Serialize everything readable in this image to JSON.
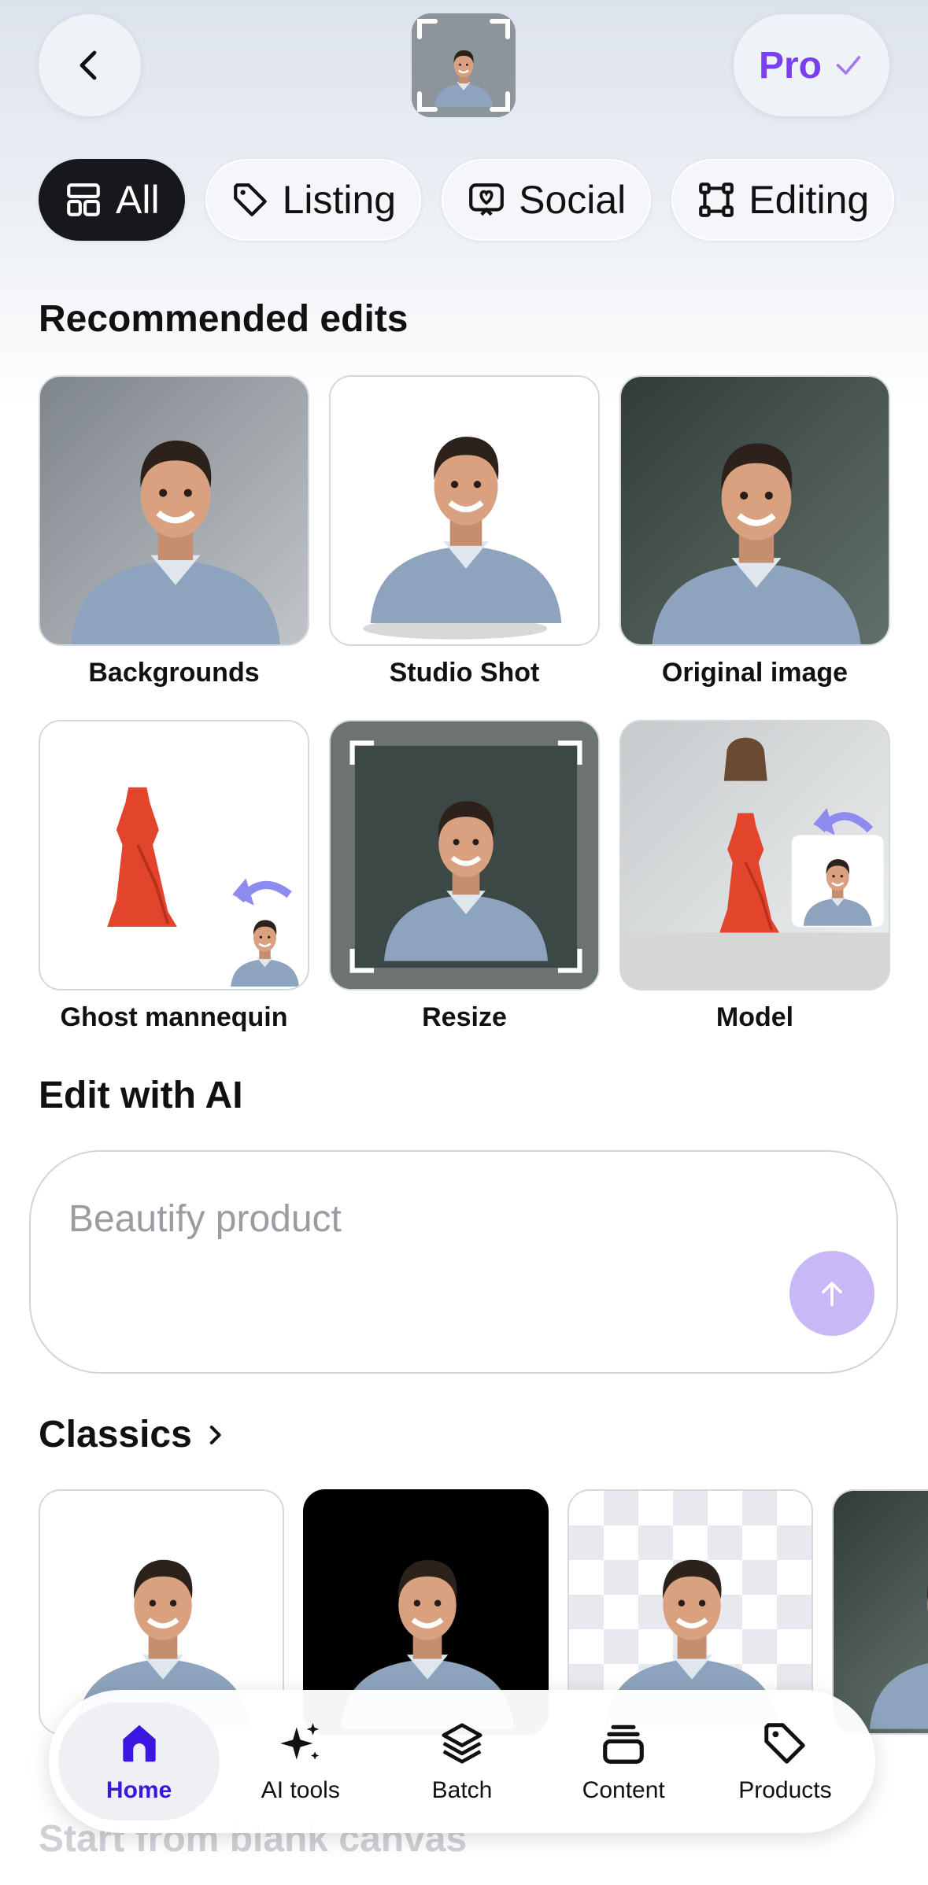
{
  "header": {
    "pro_label": "Pro"
  },
  "chips": [
    {
      "label": "All",
      "icon": "grid-icon"
    },
    {
      "label": "Listing",
      "icon": "tag-icon"
    },
    {
      "label": "Social",
      "icon": "heart-icon"
    },
    {
      "label": "Editing",
      "icon": "crop-icon"
    }
  ],
  "recommended": {
    "title": "Recommended edits",
    "items": [
      {
        "label": "Backgrounds"
      },
      {
        "label": "Studio Shot"
      },
      {
        "label": "Original image"
      },
      {
        "label": "Ghost mannequin"
      },
      {
        "label": "Resize"
      },
      {
        "label": "Model"
      }
    ]
  },
  "edit_ai": {
    "title": "Edit with AI",
    "placeholder": "Beautify product"
  },
  "classics": {
    "title": "Classics"
  },
  "blank_canvas": "Start from blank canvas",
  "nav": [
    {
      "label": "Home",
      "icon": "home-icon"
    },
    {
      "label": "AI tools",
      "icon": "sparkle-icon"
    },
    {
      "label": "Batch",
      "icon": "layers-icon"
    },
    {
      "label": "Content",
      "icon": "stack-icon"
    },
    {
      "label": "Products",
      "icon": "tag-icon"
    }
  ],
  "colors": {
    "accent": "#7b3ff2",
    "nav_active": "#3a16e0",
    "chip_active_bg": "#16181c"
  }
}
